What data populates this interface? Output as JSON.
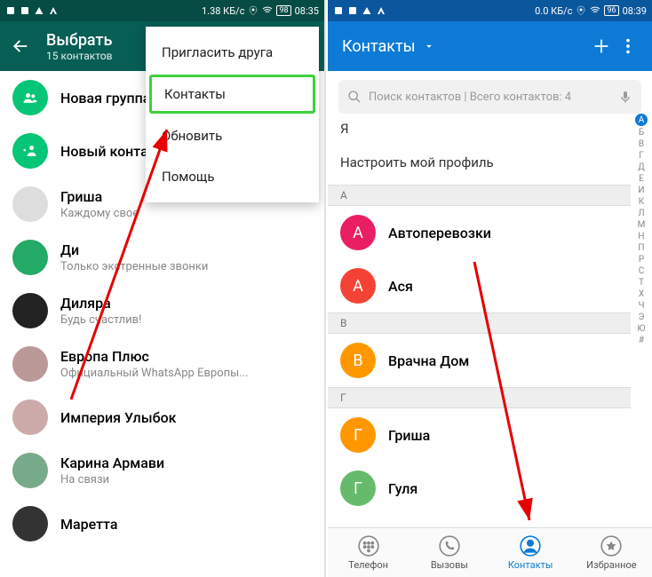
{
  "left": {
    "status": {
      "speed": "1.38 КБ/с",
      "battery": "98",
      "time": "08:35"
    },
    "header": {
      "title": "Выбрать",
      "subtitle": "15 контактов"
    },
    "menu": {
      "items": [
        {
          "label": "Пригласить друга"
        },
        {
          "label": "Контакты",
          "highlighted": true
        },
        {
          "label": "Обновить"
        },
        {
          "label": "Помощь"
        }
      ]
    },
    "items": [
      {
        "name": "Новая группа",
        "sub": "",
        "avatar": "group"
      },
      {
        "name": "Новый контакт",
        "sub": "",
        "avatar": "add"
      },
      {
        "name": "Гриша",
        "sub": "Каждому свое"
      },
      {
        "name": "Ди",
        "sub": "Только экстренные звонки"
      },
      {
        "name": "Диляра",
        "sub": "Будь счастлив!"
      },
      {
        "name": "Европа Плюс",
        "sub": "Официальный WhatsApp Европы..."
      },
      {
        "name": "Империя Улыбок",
        "sub": ""
      },
      {
        "name": "Карина Армави",
        "sub": "На связи"
      },
      {
        "name": "Маретта",
        "sub": ""
      }
    ]
  },
  "right": {
    "status": {
      "speed": "0.0 КБ/с",
      "battery": "96",
      "time": "08:39"
    },
    "header": {
      "title": "Контакты"
    },
    "search_placeholder": "Поиск контактов | Всего контактов: 4",
    "self_label": "Я",
    "profile_label": "Настроить мой профиль",
    "sections": [
      {
        "letter": "А",
        "contacts": [
          {
            "name": "Автоперевозки",
            "color": "pink"
          },
          {
            "name": "Ася",
            "color": "red"
          }
        ]
      },
      {
        "letter": "В",
        "contacts": [
          {
            "name": "Врачна Дом",
            "color": "orange"
          }
        ]
      },
      {
        "letter": "Г",
        "contacts": [
          {
            "name": "Гриша",
            "color": "orange"
          },
          {
            "name": "Гуля",
            "color": "lime"
          }
        ]
      }
    ],
    "alpha_index": [
      "А",
      "Б",
      "В",
      "Г",
      "Д",
      "Е",
      "И",
      "К",
      "Л",
      "М",
      "Н",
      "П",
      "Р",
      "С",
      "Т",
      "Х",
      "Ч",
      "Э",
      "Ю",
      "#"
    ],
    "nav": {
      "phone": "Телефон",
      "calls": "Вызовы",
      "contacts": "Контакты",
      "favorites": "Избранное"
    }
  }
}
